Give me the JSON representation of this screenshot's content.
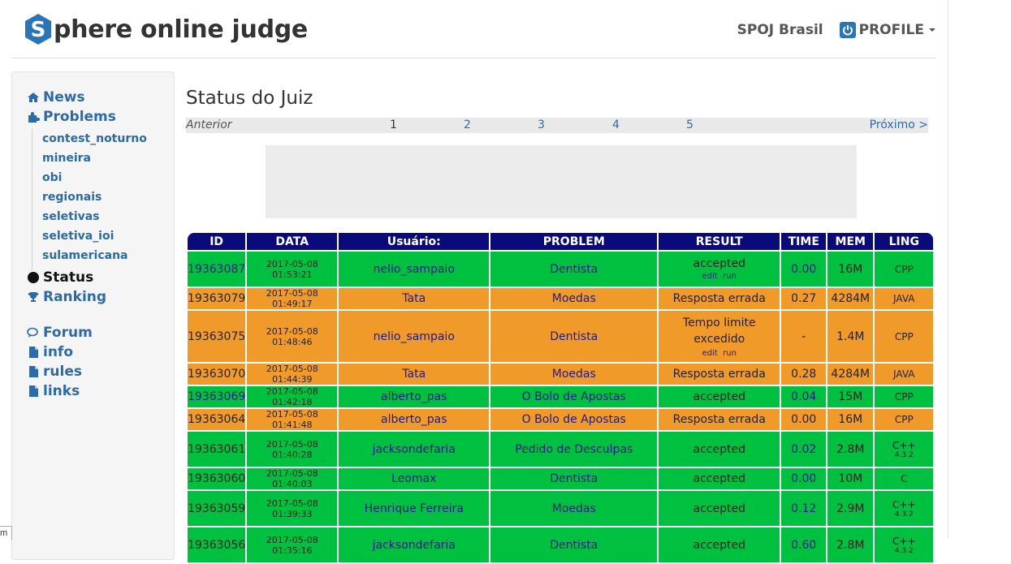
{
  "header": {
    "logo_rest": "phere online judge",
    "site_link": "SPOJ Brasil",
    "profile_label": "PROFILE"
  },
  "sidebar": {
    "news": "News",
    "problems": "Problems",
    "sub_items": [
      "contest_noturno",
      "mineira",
      "obi",
      "regionais",
      "seletivas",
      "seletiva_ioi",
      "sulamericana"
    ],
    "status": "Status",
    "ranking": "Ranking",
    "forum": "Forum",
    "info": "info",
    "rules": "rules",
    "links": "links"
  },
  "main": {
    "title": "Status do Juiz",
    "pager": {
      "prev": "Anterior",
      "pages": [
        "1",
        "2",
        "3",
        "4",
        "5"
      ],
      "current_page": "1",
      "next": "Próximo >"
    }
  },
  "table": {
    "headers": [
      "ID",
      "DATA",
      "Usuário:",
      "PROBLEM",
      "RESULT",
      "TIME",
      "MEM",
      "LING"
    ],
    "edit_label": "edit",
    "run_label": "run",
    "rows": [
      {
        "id": "19363087",
        "date": "2017-05-08 01:53:21",
        "user": "nelio_sampaio",
        "problem": "Dentista",
        "result": "accepted",
        "time": "0.00",
        "mem": "16M",
        "lang": "CPP",
        "lang_ver": ""
      },
      {
        "id": "19363079",
        "date": "2017-05-08 01:49:17",
        "user": "Tata",
        "problem": "Moedas",
        "result": "Resposta errada",
        "time": "0.27",
        "mem": "4284M",
        "lang": "JAVA",
        "lang_ver": ""
      },
      {
        "id": "19363075",
        "date": "2017-05-08 01:48:46",
        "user": "nelio_sampaio",
        "problem": "Dentista",
        "result_line1": "Tempo limite",
        "result_line2": "excedido",
        "time": "-",
        "mem": "1.4M",
        "lang": "CPP",
        "lang_ver": ""
      },
      {
        "id": "19363070",
        "date": "2017-05-08 01:44:39",
        "user": "Tata",
        "problem": "Moedas",
        "result": "Resposta errada",
        "time": "0.28",
        "mem": "4284M",
        "lang": "JAVA",
        "lang_ver": ""
      },
      {
        "id": "19363069",
        "date": "2017-05-08 01:42:18",
        "user": "alberto_pas",
        "problem": "O Bolo de Apostas",
        "result": "accepted",
        "time": "0.04",
        "mem": "15M",
        "lang": "CPP",
        "lang_ver": ""
      },
      {
        "id": "19363064",
        "date": "2017-05-08 01:41:48",
        "user": "alberto_pas",
        "problem": "O Bolo de Apostas",
        "result": "Resposta errada",
        "time": "0.00",
        "mem": "16M",
        "lang": "CPP",
        "lang_ver": ""
      },
      {
        "id": "19363061",
        "date": "2017-05-08 01:40:28",
        "user": "jacksondefaria",
        "problem": "Pedido de Desculpas",
        "result": "accepted",
        "time": "0.02",
        "mem": "2.8M",
        "lang": "C++",
        "lang_ver": "4.3.2"
      },
      {
        "id": "19363060",
        "date": "2017-05-08 01:40:03",
        "user": "Leomax",
        "problem": "Dentista",
        "result": "accepted",
        "time": "0.00",
        "mem": "10M",
        "lang": "C",
        "lang_ver": ""
      },
      {
        "id": "19363059",
        "date": "2017-05-08 01:39:33",
        "user": "Henrique Ferreira",
        "problem": "Moedas",
        "result": "accepted",
        "time": "0.12",
        "mem": "2.9M",
        "lang": "C++",
        "lang_ver": "4.3.2"
      },
      {
        "id": "19363056",
        "date": "2017-05-08 01:35:16",
        "user": "jacksondefaria",
        "problem": "Dentista",
        "result": "accepted",
        "time": "0.60",
        "mem": "2.8M",
        "lang": "C++",
        "lang_ver": "4.3.2"
      }
    ]
  },
  "colors": {
    "accepted_row": "#00c040",
    "rejected_row": "#f09a2a",
    "header_row": "#0a0a7a",
    "link": "#2d6aa8"
  },
  "corner_text": "m"
}
